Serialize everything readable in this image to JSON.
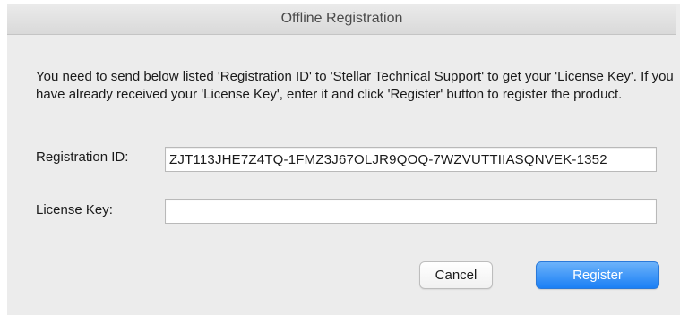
{
  "window": {
    "title": "Offline Registration"
  },
  "message": "You need to send below listed 'Registration ID' to 'Stellar Technical Support' to get your 'License Key'. If you have already received your 'License Key', enter it and click 'Register' button to register the product.",
  "registration": {
    "label": "Registration ID:",
    "value": "ZJT113JHE7Z4TQ-1FMZ3J67OLJR9QOQ-7WZVUTTIIASQNVEK-1352"
  },
  "license": {
    "label": "License Key:",
    "value": ""
  },
  "buttons": {
    "cancel": "Cancel",
    "register": "Register"
  },
  "colors": {
    "primary_button": "#1b7ff5",
    "window_background": "#ececec"
  }
}
